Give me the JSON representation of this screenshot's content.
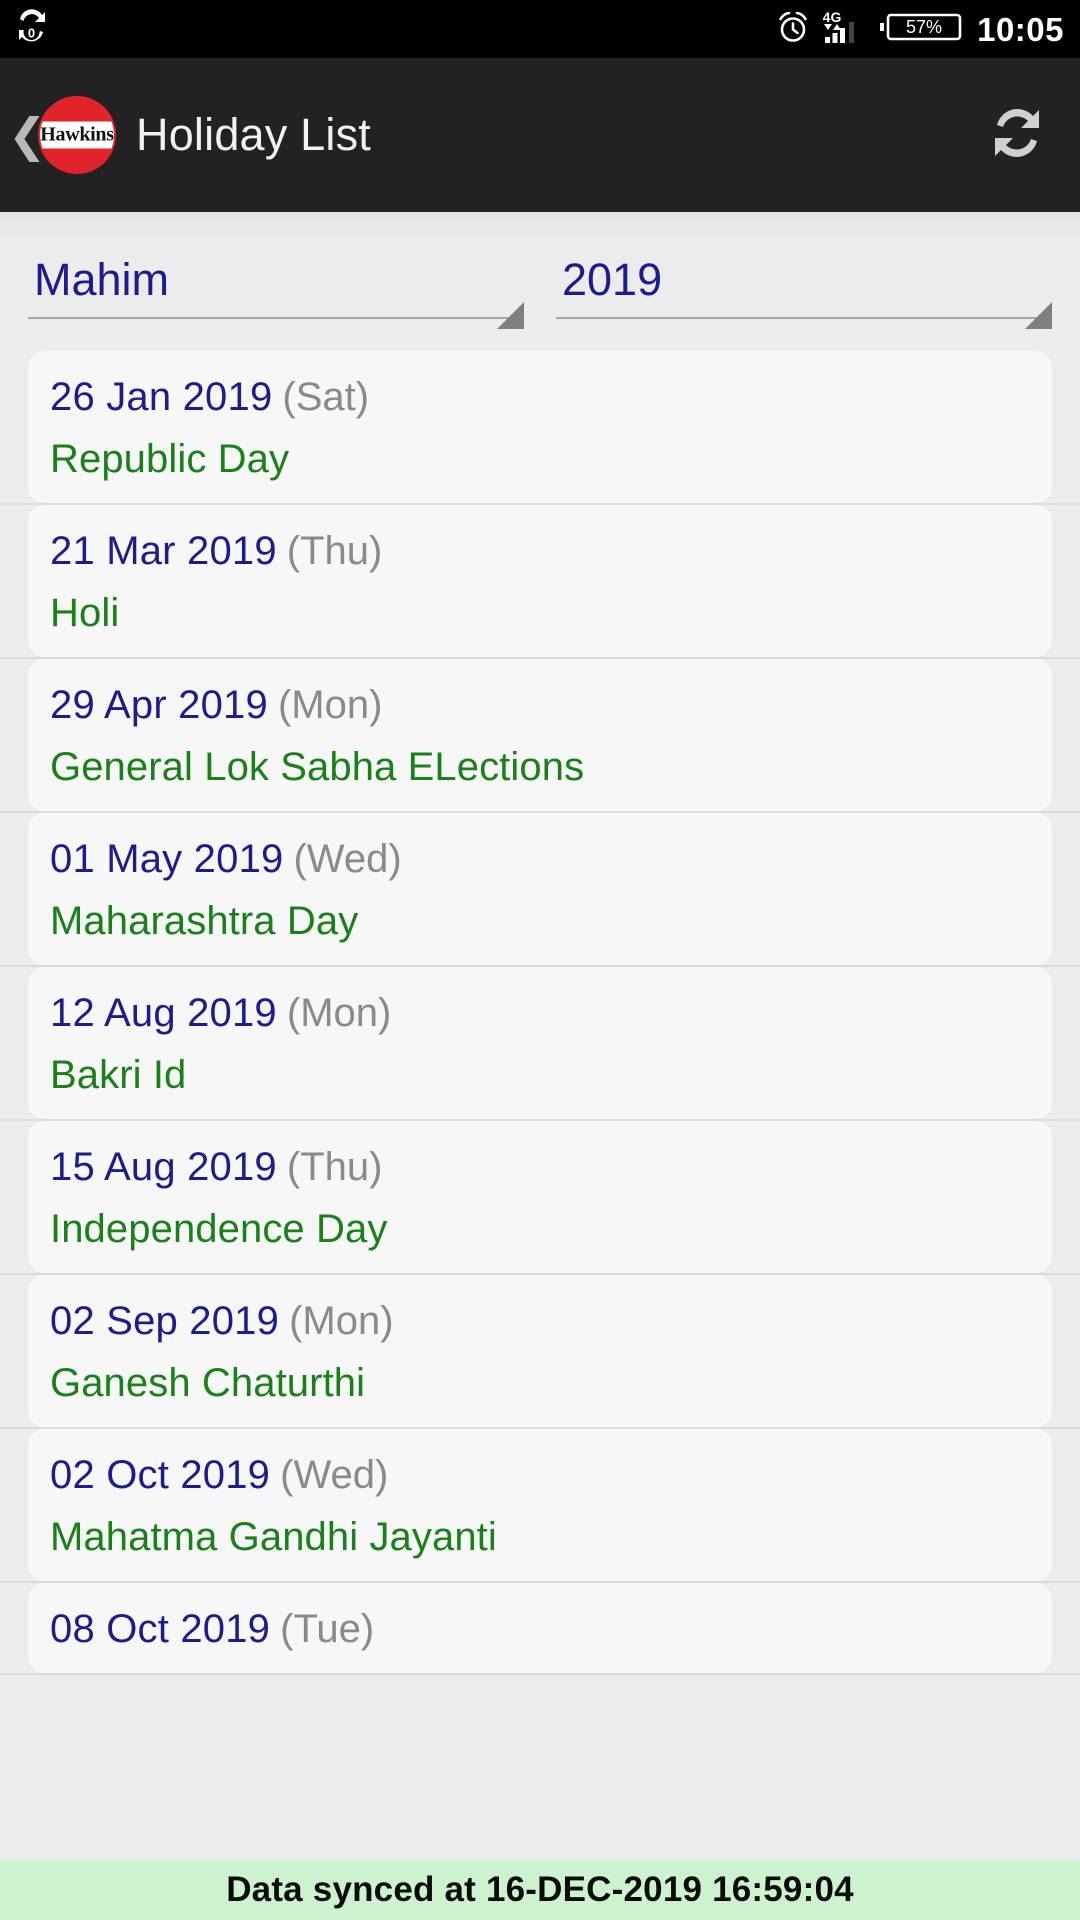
{
  "status_bar": {
    "left_icon": "sync-notification-icon",
    "alarm_icon": "alarm-clock-icon",
    "network_label": "4G",
    "signal_icon": "signal-bars-icon",
    "battery_percent": "57%",
    "clock": "10:05"
  },
  "app_bar": {
    "back_icon": "back-chevron-icon",
    "brand": "Hawkins",
    "title": "Holiday List",
    "refresh_icon": "refresh-icon"
  },
  "filters": {
    "location": {
      "value": "Mahim",
      "caret_icon": "dropdown-caret-icon"
    },
    "year": {
      "value": "2019",
      "caret_icon": "dropdown-caret-icon"
    }
  },
  "holidays": [
    {
      "date": "26 Jan 2019",
      "day": "(Sat)",
      "name": "Republic Day"
    },
    {
      "date": "21 Mar 2019",
      "day": "(Thu)",
      "name": "Holi"
    },
    {
      "date": "29 Apr 2019",
      "day": "(Mon)",
      "name": "General Lok Sabha ELections"
    },
    {
      "date": "01 May 2019",
      "day": "(Wed)",
      "name": "Maharashtra Day"
    },
    {
      "date": "12 Aug 2019",
      "day": "(Mon)",
      "name": "Bakri Id"
    },
    {
      "date": "15 Aug 2019",
      "day": "(Thu)",
      "name": "Independence Day"
    },
    {
      "date": "02 Sep 2019",
      "day": "(Mon)",
      "name": "Ganesh Chaturthi"
    },
    {
      "date": "02 Oct 2019",
      "day": "(Wed)",
      "name": "Mahatma Gandhi Jayanti"
    },
    {
      "date": "08 Oct 2019",
      "day": "(Tue)",
      "name": ""
    }
  ],
  "sync_banner": {
    "text": "Data synced at 16-DEC-2019 16:59:04"
  },
  "colors": {
    "status_bar_bg": "#000000",
    "app_bar_bg": "#222222",
    "brand_red": "#e1232a",
    "date_navy": "#1c1c8f",
    "day_gray": "#8a8a8a",
    "holiday_green": "#1a8019",
    "banner_green": "#cdf3ce",
    "page_bg": "#ececec"
  }
}
